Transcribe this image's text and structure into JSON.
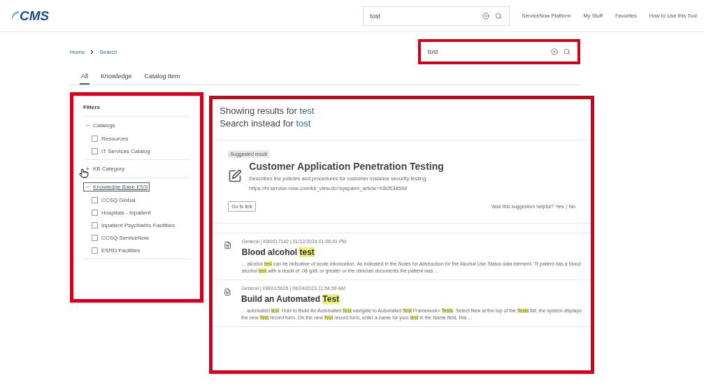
{
  "header": {
    "logo": "CMS",
    "search": {
      "value": "tost"
    },
    "nav": [
      "ServiceNow Platform",
      "My Stuff",
      "Favorites",
      "How to Use this Tool"
    ]
  },
  "breadcrumb": [
    "Home",
    "Search"
  ],
  "page_search": {
    "value": "tost",
    "annotated": true
  },
  "tabs": [
    {
      "label": "All",
      "selected": true
    },
    {
      "label": "Knowledge",
      "selected": false
    },
    {
      "label": "Catalog Item",
      "selected": false
    }
  ],
  "filters": {
    "title": "Filters",
    "annotated": true,
    "groups": [
      {
        "label": "Catalogs",
        "expanded": true,
        "focused": false,
        "children": [
          {
            "label": "Resources",
            "checked": false
          },
          {
            "label": "IT Services Catalog",
            "checked": false
          }
        ]
      },
      {
        "label": "KB Category",
        "expanded": false,
        "focused": false
      },
      {
        "label": "Knowledge Base ESS",
        "expanded": true,
        "focused": true,
        "children": [
          {
            "label": "CCSQ Global",
            "checked": false
          },
          {
            "label": "Hospitals - Inpatient",
            "checked": false
          },
          {
            "label": "Inpatient Psychiatric Facilities",
            "checked": false
          },
          {
            "label": "CCSQ ServiceNow",
            "checked": false
          },
          {
            "label": "ESRD Facilities",
            "checked": false
          }
        ]
      }
    ]
  },
  "results": {
    "annotated": true,
    "showing_label": "Showing results for",
    "showing_term": "test",
    "instead_label": "Search instead for",
    "instead_term": "tost",
    "suggested": {
      "badge": "Suggested result",
      "title": "Customer Application Penetration Testing",
      "description": "Describes the policies and procedures for customer instance security testing.",
      "url": "https://hi.service-now.com/kb_view.do?sysparm_article=KB0538598",
      "button": "Go to link",
      "helpful_label": "Was this suggestion helpful?",
      "yes": "Yes",
      "separator": "|",
      "no": "No"
    },
    "items": [
      {
        "meta": "General | KB0017142 | 01/12/2024 01:06:41 PM",
        "title": [
          {
            "text": "Blood alcohol ",
            "hit": false
          },
          {
            "text": "test",
            "hit": true
          }
        ],
        "snippet": [
          {
            "text": "... alcohol ",
            "hit": false
          },
          {
            "text": "test",
            "hit": true
          },
          {
            "text": " can be indicative of acute intoxication. As indicated in the Notes for Abstraction for the Alcohol Use Status data element, \"If patient has a blood alcohol ",
            "hit": false
          },
          {
            "text": "test",
            "hit": true
          },
          {
            "text": " with a result of .08 g/dL or greater or the clinician documents the patient was ...",
            "hit": false
          }
        ]
      },
      {
        "meta": "General | KB0015626 | 08/24/2023 11:54:59 AM",
        "title": [
          {
            "text": "Build an Automated ",
            "hit": false
          },
          {
            "text": "Test",
            "hit": true
          }
        ],
        "snippet": [
          {
            "text": "... automated ",
            "hit": false
          },
          {
            "text": "test",
            "hit": true
          },
          {
            "text": ". How to Build An Automated ",
            "hit": false
          },
          {
            "text": "Test",
            "hit": true
          },
          {
            "text": " navigate to Automated ",
            "hit": false
          },
          {
            "text": "Test",
            "hit": true
          },
          {
            "text": " Framework> ",
            "hit": false
          },
          {
            "text": "Tests",
            "hit": true
          },
          {
            "text": ". Select New at the top of the ",
            "hit": false
          },
          {
            "text": "Tests",
            "hit": true
          },
          {
            "text": " list; the system displays the new ",
            "hit": false
          },
          {
            "text": "Test",
            "hit": true
          },
          {
            "text": " record form. On the new ",
            "hit": false
          },
          {
            "text": "Test",
            "hit": true
          },
          {
            "text": " record form, enter a name for your ",
            "hit": false
          },
          {
            "text": "test",
            "hit": true
          },
          {
            "text": " in the Name field. this ...",
            "hit": false
          }
        ]
      }
    ]
  }
}
